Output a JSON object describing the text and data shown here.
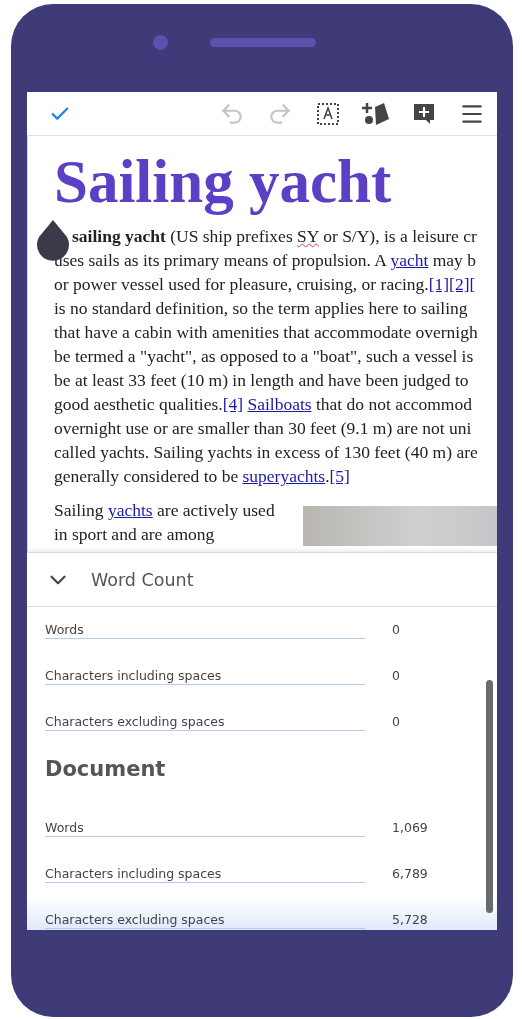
{
  "document": {
    "title": "Sailing yacht",
    "lines": [
      [
        {
          "kind": "bold",
          "text": "sailing yacht"
        },
        {
          "kind": "text",
          "text": " (US ship prefixes "
        },
        {
          "kind": "misspelled",
          "text": "SY"
        },
        {
          "kind": "text",
          "text": " or S/Y), is a leisure cr"
        }
      ],
      [
        {
          "kind": "text",
          "text": "uses sails as its primary means of propulsion. A "
        },
        {
          "kind": "link",
          "text": "yacht"
        },
        {
          "kind": "text",
          "text": " may b"
        }
      ],
      [
        {
          "kind": "text",
          "text": "or power vessel used for pleasure, cruising, or racing."
        },
        {
          "kind": "link",
          "text": "[1][2]["
        }
      ],
      [
        {
          "kind": "text",
          "text": "is no standard definition, so the term applies here to sailing"
        }
      ],
      [
        {
          "kind": "text",
          "text": "that have a cabin with amenities that accommodate overnigh"
        }
      ],
      [
        {
          "kind": "text",
          "text": "be termed a \"yacht\", as opposed to a \"boat\", such a vessel is"
        }
      ],
      [
        {
          "kind": "text",
          "text": "be at least 33 feet (10 m) in length and have been judged to"
        }
      ],
      [
        {
          "kind": "text",
          "text": "good aesthetic qualities."
        },
        {
          "kind": "link",
          "text": "[4]"
        },
        {
          "kind": "link_spaced",
          "text": "Sailboats"
        },
        {
          "kind": "text",
          "text": " that do not accommod"
        }
      ],
      [
        {
          "kind": "text",
          "text": "overnight use or are smaller than 30 feet (9.1 m) are not uni"
        }
      ],
      [
        {
          "kind": "text",
          "text": "called yachts. Sailing yachts in excess of 130 feet (40 m) are"
        }
      ],
      [
        {
          "kind": "text",
          "text": "generally considered to be "
        },
        {
          "kind": "link",
          "text": "superyachts"
        },
        {
          "kind": "text",
          "text": "."
        },
        {
          "kind": "link",
          "text": "[5]"
        }
      ]
    ],
    "lines_2": [
      [
        {
          "kind": "text",
          "text": "Sailing "
        },
        {
          "kind": "link",
          "text": "yachts"
        },
        {
          "kind": "text",
          "text": " are actively used"
        }
      ],
      [
        {
          "kind": "text",
          "text": "in sport and are among"
        }
      ]
    ]
  },
  "word_count": {
    "title": "Word Count",
    "expanded": true,
    "sections": [
      {
        "rows": [
          {
            "label": "Words",
            "value": "0"
          },
          {
            "label": "Characters including spaces",
            "value": "0"
          },
          {
            "label": "Characters excluding spaces",
            "value": "0"
          }
        ]
      },
      {
        "title": "Document",
        "rows": [
          {
            "label": "Words",
            "value": "1,069"
          },
          {
            "label": "Characters including spaces",
            "value": "6,789"
          },
          {
            "label": "Characters excluding spaces",
            "value": "5,728"
          }
        ]
      }
    ]
  }
}
